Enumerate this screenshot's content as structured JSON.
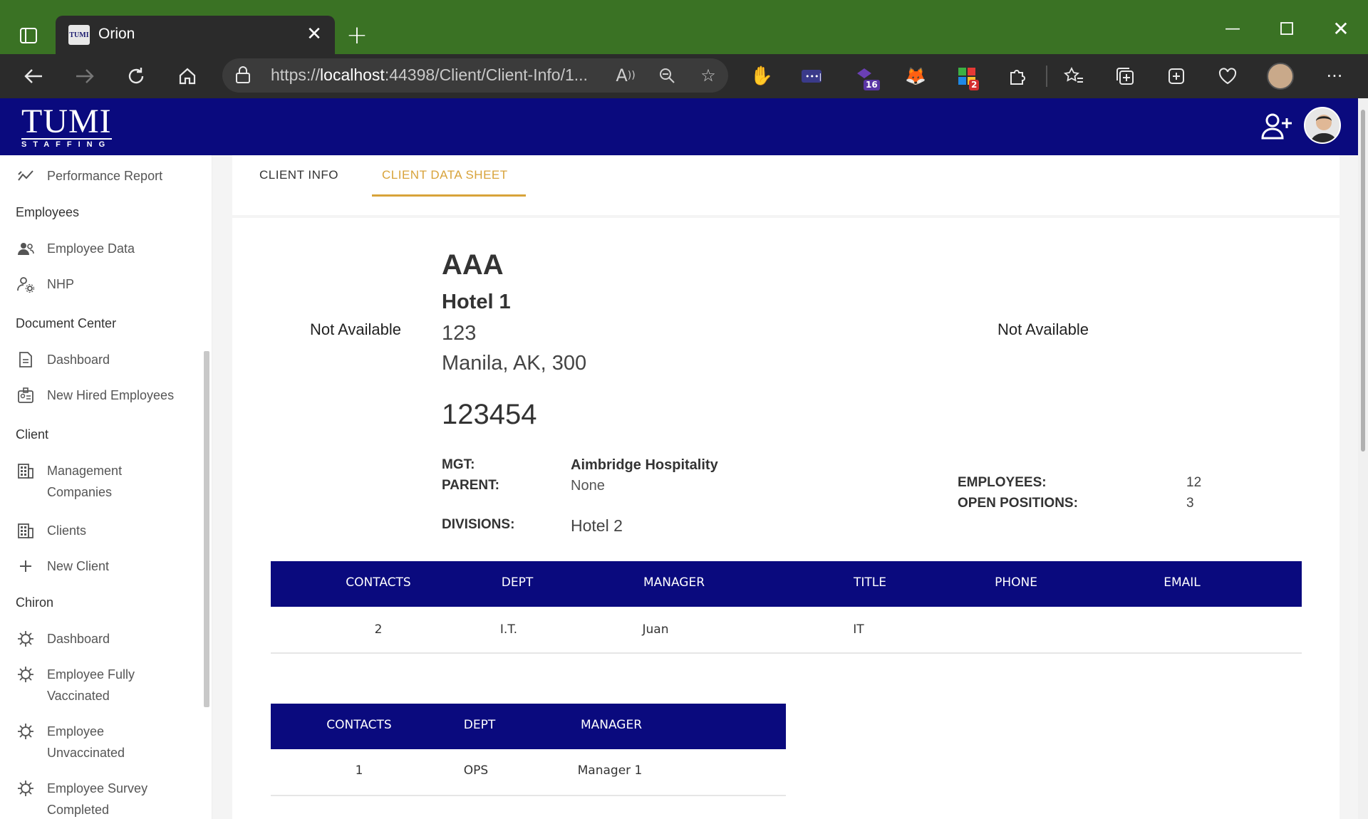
{
  "browser": {
    "tab_title": "Orion",
    "favicon_text": "TUMI",
    "url_prefix": "https://",
    "url_host": "localhost",
    "url_rest": ":44398/Client/Client-Info/1...",
    "extension_badges": {
      "ext1": "16",
      "ext2": "2"
    }
  },
  "app": {
    "logo_main": "TUMI",
    "logo_sub": "STAFFING"
  },
  "sidebar": {
    "performance_report": "Performance Report",
    "employees_header": "Employees",
    "employee_data": "Employee Data",
    "nhp": "NHP",
    "document_center_header": "Document Center",
    "dashboard": "Dashboard",
    "new_hired": "New Hired Employees",
    "client_header": "Client",
    "management_line1": "Management",
    "management_line2": "Companies",
    "clients": "Clients",
    "new_client": "New Client",
    "chiron_header": "Chiron",
    "chiron_dashboard": "Dashboard",
    "vaccinated_line1": "Employee Fully",
    "vaccinated_line2": "Vaccinated",
    "unvaccinated_line1": "Employee",
    "unvaccinated_line2": "Unvaccinated",
    "survey_line1": "Employee Survey",
    "survey_line2": "Completed"
  },
  "tabs": {
    "client_info": "CLIENT INFO",
    "client_data_sheet": "CLIENT DATA SHEET"
  },
  "client": {
    "logo_left": "Not Available",
    "logo_right": "Not Available",
    "name": "AAA",
    "hotel": "Hotel 1",
    "street": "123",
    "city_line": "Manila, AK, 300",
    "phone": "123454",
    "mgt_label": "MGT:",
    "mgt_value": "Aimbridge Hospitality",
    "parent_label": "PARENT:",
    "parent_value": "None",
    "divisions_label": "DIVISIONS:",
    "divisions_value": "Hotel 2",
    "employees_label": "EMPLOYEES:",
    "employees_value": "12",
    "open_positions_label": "OPEN POSITIONS:",
    "open_positions_value": "3"
  },
  "table1": {
    "headers": [
      "CONTACTS",
      "DEPT",
      "MANAGER",
      "TITLE",
      "PHONE",
      "EMAIL"
    ],
    "rows": [
      [
        "2",
        "I.T.",
        "Juan",
        "IT",
        "",
        ""
      ]
    ]
  },
  "table2": {
    "headers": [
      "CONTACTS",
      "DEPT",
      "MANAGER"
    ],
    "rows": [
      [
        "1",
        "OPS",
        "Manager 1"
      ]
    ]
  },
  "colors": {
    "brand_navy": "#0a0a7e",
    "accent_gold": "#d8a33a",
    "browser_green": "#3a7224"
  }
}
